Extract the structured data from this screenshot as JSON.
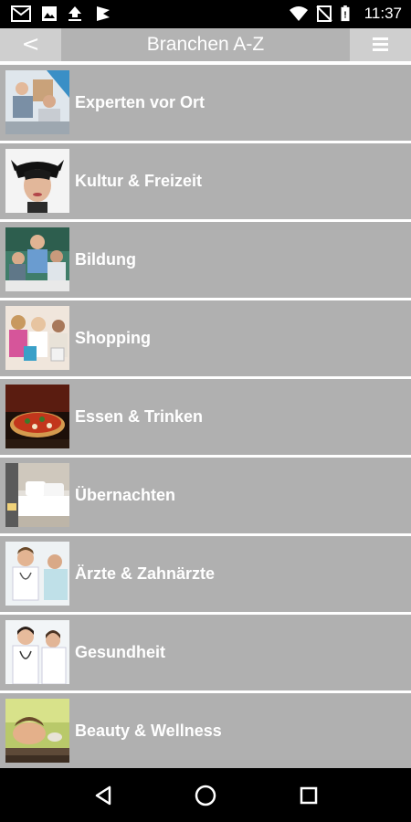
{
  "status_bar": {
    "time": "11:37",
    "icons": [
      "gmail-icon",
      "image-icon",
      "upload-icon",
      "flag-icon",
      "wifi-icon",
      "no-sim-icon",
      "battery-icon"
    ]
  },
  "header": {
    "back_label": "<",
    "title": "Branchen A-Z",
    "menu_icon": "hamburger-icon"
  },
  "list": {
    "items": [
      {
        "label": "Experten vor Ort",
        "thumb": "consultants"
      },
      {
        "label": "Kultur & Freizeit",
        "thumb": "masked-woman"
      },
      {
        "label": "Bildung",
        "thumb": "classroom"
      },
      {
        "label": "Shopping",
        "thumb": "shoppers"
      },
      {
        "label": "Essen & Trinken",
        "thumb": "pizza"
      },
      {
        "label": "Übernachten",
        "thumb": "hotel-bed"
      },
      {
        "label": "Ärzte & Zahnärzte",
        "thumb": "doctor"
      },
      {
        "label": "Gesundheit",
        "thumb": "medical-team"
      },
      {
        "label": "Beauty & Wellness",
        "thumb": "spa"
      }
    ]
  },
  "nav_bar": {
    "buttons": [
      "back-triangle-icon",
      "home-circle-icon",
      "recents-square-icon"
    ]
  },
  "colors": {
    "header_bg": "#b3b3b3",
    "header_button_bg": "#cfcfcf",
    "item_bg": "#b0b0b0",
    "text": "#ffffff"
  }
}
